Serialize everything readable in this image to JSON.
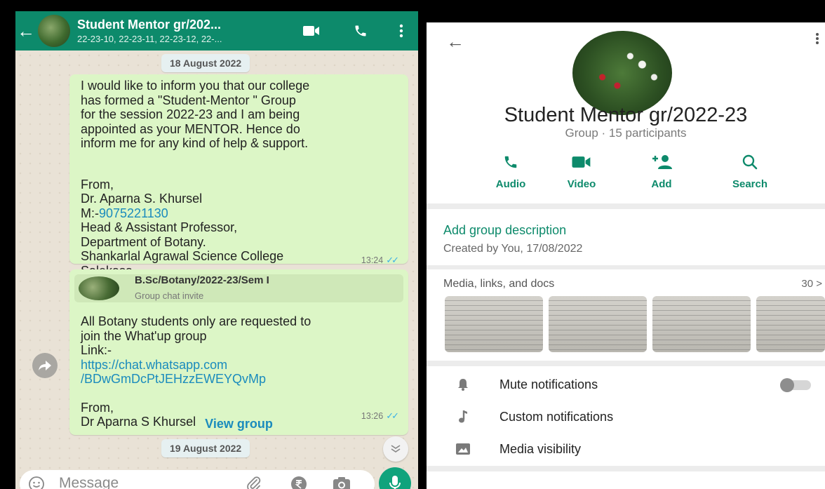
{
  "chat": {
    "header": {
      "title": "Student Mentor gr/202...",
      "subtitle": "22-23-10, 22-23-11, 22-23-12, 22-..."
    },
    "date_top": "18 August 2022",
    "message1": {
      "text_a": "I would like to inform you that our college\nhas formed a \"Student-Mentor \" Group\nfor the session 2022-23 and I am being\nappointed as your MENTOR. Hence do\ninform me for any kind of help & support.",
      "from_label": "From,",
      "name": "Dr. Aparna S. Khursel",
      "phone_prefix": "M:-",
      "phone": "9075221130",
      "text_b": "Head & Assistant Professor,\nDepartment of Botany.\nShankarlal Agrawal Science College\nSalekasa,\nDistrict Gondia.",
      "time": "13:24"
    },
    "message2": {
      "invite_title": "B.Sc/Botany/2022-23/Sem I",
      "invite_subtitle": "Group chat invite",
      "text_a": "All Botany students only are requested to\njoin the What'up group\nLink:-",
      "link": "https://chat.whatsapp.com\n/BDwGmDcPtJEHzzEWEYQvMp",
      "from_label": "From,",
      "name": "Dr Aparna S Khursel",
      "time": "13:26",
      "view_group": "View group"
    },
    "date_bottom": "19 August 2022",
    "composer": {
      "placeholder": "Message"
    }
  },
  "info": {
    "group_name": "Student Mentor gr/2022-23",
    "group_meta": "Group · 15 participants",
    "actions": [
      {
        "label": "Audio",
        "icon": "phone-icon"
      },
      {
        "label": "Video",
        "icon": "video-icon"
      },
      {
        "label": "Add",
        "icon": "add-person-icon"
      },
      {
        "label": "Search",
        "icon": "search-icon"
      }
    ],
    "add_description": "Add group description",
    "created": "Created by You, 17/08/2022",
    "media_title": "Media, links, and docs",
    "media_count": "30 >",
    "settings": {
      "mute": "Mute notifications",
      "mute_on": false,
      "custom": "Custom notifications",
      "media_visibility": "Media visibility"
    }
  },
  "colors": {
    "header_green": "#0d8a6b",
    "bubble_green": "#dcf6c6",
    "link_blue": "#1a8bbd",
    "tick_blue": "#3ab0e6"
  }
}
